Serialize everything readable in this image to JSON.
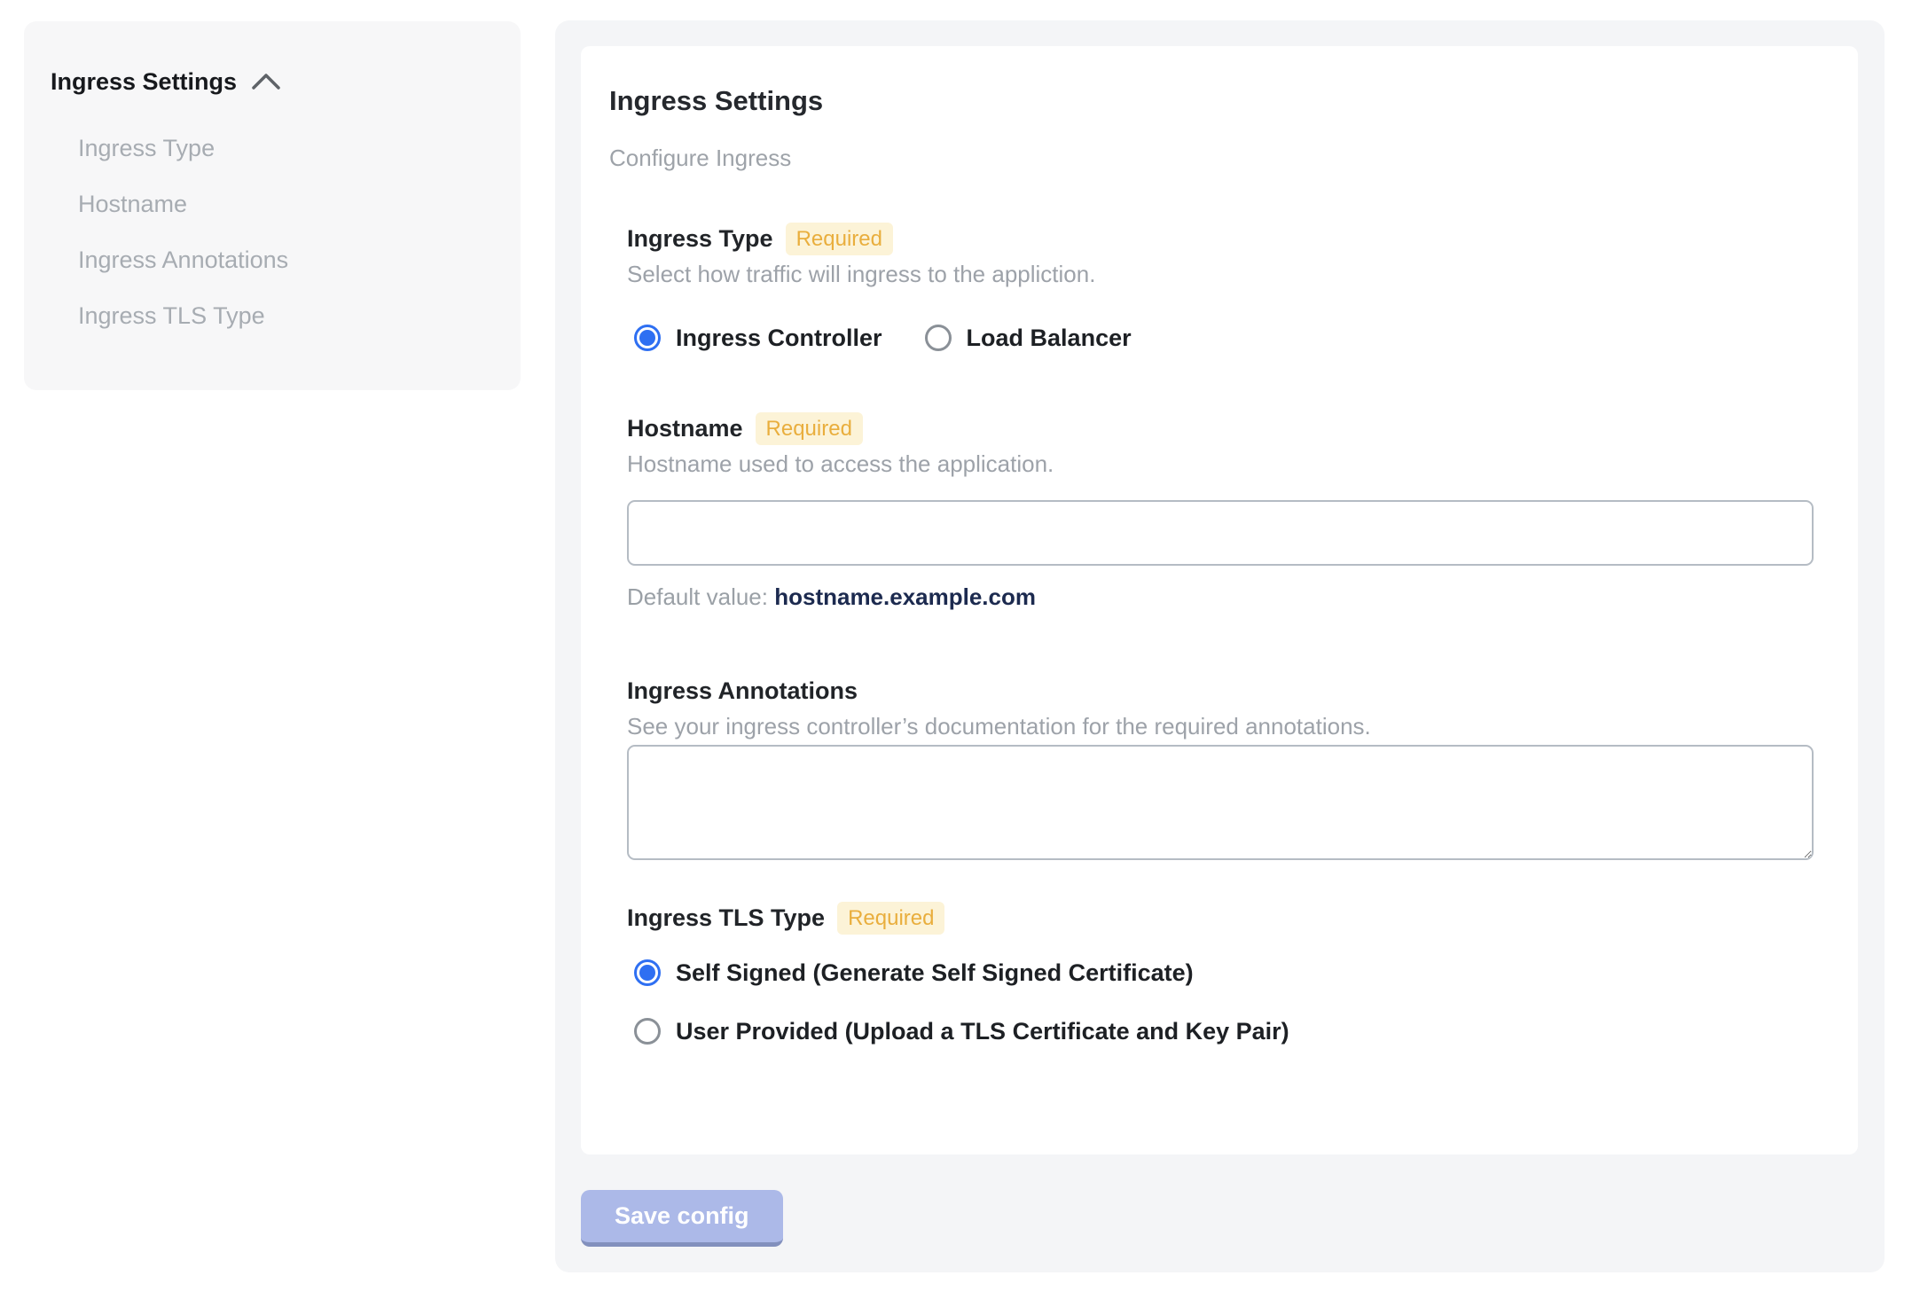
{
  "sidebar": {
    "title": "Ingress Settings",
    "items": [
      {
        "label": "Ingress Type"
      },
      {
        "label": "Hostname"
      },
      {
        "label": "Ingress Annotations"
      },
      {
        "label": "Ingress TLS Type"
      }
    ]
  },
  "main": {
    "title": "Ingress Settings",
    "subtitle": "Configure Ingress",
    "fields": {
      "ingress_type": {
        "label": "Ingress Type",
        "required_label": "Required",
        "helper": "Select how traffic will ingress to the appliction.",
        "options": [
          {
            "label": "Ingress Controller",
            "selected": true
          },
          {
            "label": "Load Balancer",
            "selected": false
          }
        ]
      },
      "hostname": {
        "label": "Hostname",
        "required_label": "Required",
        "helper": "Hostname used to access the application.",
        "value": "",
        "default_value_label": "Default value: ",
        "default_value": "hostname.example.com"
      },
      "ingress_annotations": {
        "label": "Ingress Annotations",
        "helper": "See your ingress controller’s documentation for the required annotations.",
        "value": ""
      },
      "ingress_tls_type": {
        "label": "Ingress TLS Type",
        "required_label": "Required",
        "options": [
          {
            "label": "Self Signed (Generate Self Signed Certificate)",
            "selected": true
          },
          {
            "label": "User Provided (Upload a TLS Certificate and Key Pair)",
            "selected": false
          }
        ]
      }
    },
    "save_button_label": "Save config"
  },
  "colors": {
    "accent_blue": "#2e6ff2",
    "badge_bg": "#fcf3d7",
    "badge_text": "#e9ae3d",
    "save_button_bg": "#acb9e8",
    "save_button_edge": "#8290bd",
    "default_value_text": "#1c2a4f"
  }
}
